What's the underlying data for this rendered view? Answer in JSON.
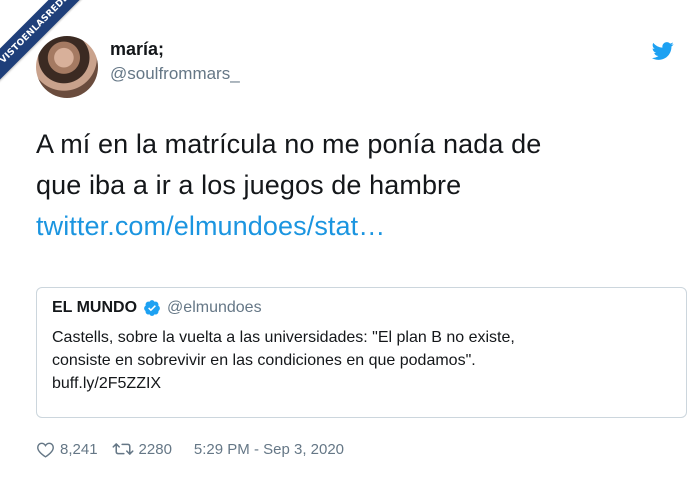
{
  "watermark": {
    "text": "VISTOENLASREDES"
  },
  "tweet": {
    "author_name": "maría;",
    "author_handle": "@soulfrommars_",
    "text_line1": "A mí en la matrícula no me ponía nada de",
    "text_line2": "que iba a ir a los juegos de hambre",
    "link_text": "twitter.com/elmundoes/stat…",
    "likes": "8,241",
    "retweets": "2280",
    "timestamp": "5:29 PM - Sep 3, 2020"
  },
  "quoted": {
    "author_name": "EL MUNDO",
    "author_handle": "@elmundoes",
    "verified": true,
    "text_line1": "Castells, sobre la vuelta a las universidades: \"El plan B no existe,",
    "text_line2": "consiste en sobrevivir en las condiciones en que podamos\".",
    "link_text": "buff.ly/2F5ZZIX"
  },
  "colors": {
    "link": "#1b95e0",
    "secondary_text": "#657786",
    "twitter_blue": "#1da1f2",
    "border": "#ccd6dd",
    "ribbon": "#1f3f7a"
  },
  "icons": [
    "twitter-bird-icon",
    "verified-badge-icon",
    "heart-icon",
    "retweet-icon"
  ]
}
